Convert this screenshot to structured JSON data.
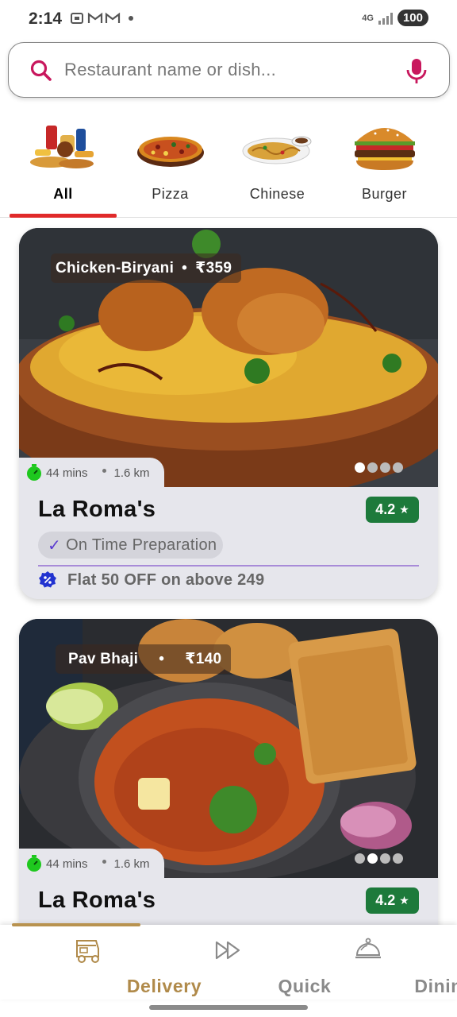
{
  "status_bar": {
    "time": "2:14",
    "network": "4G",
    "battery": "100"
  },
  "search": {
    "placeholder": "Restaurant name or dish..."
  },
  "categories": [
    {
      "label": "All"
    },
    {
      "label": "Pizza"
    },
    {
      "label": "Chinese"
    },
    {
      "label": "Burger"
    }
  ],
  "cards": [
    {
      "dish": "Chicken-Biryani",
      "separator": "•",
      "price": "₹359",
      "eta": "44 mins",
      "distance": "1.6 km",
      "restaurant": "La Roma's",
      "rating": "4.2",
      "badge": "On Time Preparation",
      "offer": "Flat 50 OFF on above 249",
      "carousel_active": 0,
      "carousel_count": 4
    },
    {
      "dish": "Pav Bhaji",
      "separator": "•",
      "price": "₹140",
      "eta": "44 mins",
      "distance": "1.6 km",
      "restaurant": "La Roma's",
      "rating": "4.2",
      "carousel_active": 1,
      "carousel_count": 4
    }
  ],
  "bottom_nav": [
    {
      "label": "Delivery",
      "icon": "auto-rickshaw-icon"
    },
    {
      "label": "Quick",
      "icon": "fast-forward-icon"
    },
    {
      "label": "Dining",
      "icon": "cloche-icon"
    }
  ],
  "colors": {
    "accent_red": "#e02a2a",
    "rating_green": "#1d7a3b",
    "nav_gold": "#b08a4a",
    "offer_blue": "#2233d0"
  }
}
